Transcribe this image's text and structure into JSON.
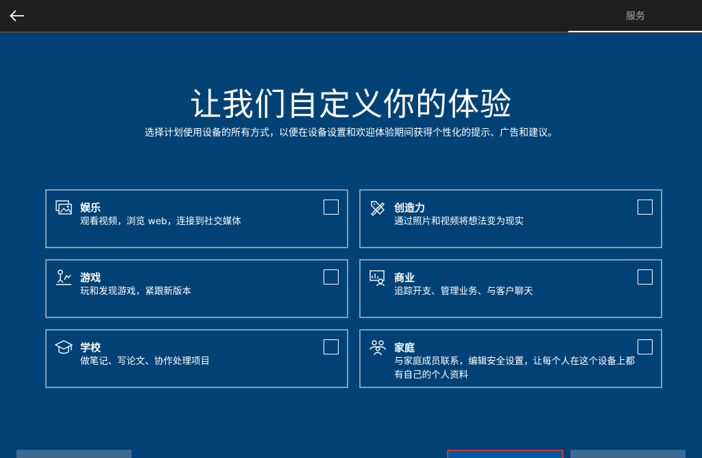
{
  "header": {
    "step_label": "服务"
  },
  "main": {
    "title": "让我们自定义你的体验",
    "subtitle": "选择计划使用设备的所有方式，以便在设备设置和欢迎体验期间获得个性化的提示、广告和建议。"
  },
  "cards": [
    {
      "icon": "media-icon",
      "title": "娱乐",
      "desc": "观看视频，浏览 web，连接到社交媒体",
      "checked": false
    },
    {
      "icon": "creativity-icon",
      "title": "创造力",
      "desc": "通过照片和视频将想法变为现实",
      "checked": false
    },
    {
      "icon": "gaming-icon",
      "title": "游戏",
      "desc": "玩和发现游戏，紧跟新版本",
      "checked": false
    },
    {
      "icon": "business-icon",
      "title": "商业",
      "desc": "追踪开支、管理业务、与客户聊天",
      "checked": false
    },
    {
      "icon": "school-icon",
      "title": "学校",
      "desc": "做笔记、写论文、协作处理项目",
      "checked": false
    },
    {
      "icon": "family-icon",
      "title": "家庭",
      "desc": "与家庭成员联系，编辑安全设置，让每个人在这个设备上都有自己的个人资料",
      "checked": false
    }
  ],
  "colors": {
    "background": "#004275",
    "topbar": "#1f1f1f",
    "card_border": "#7f9fb9",
    "accept_button_border": "#d13438"
  }
}
